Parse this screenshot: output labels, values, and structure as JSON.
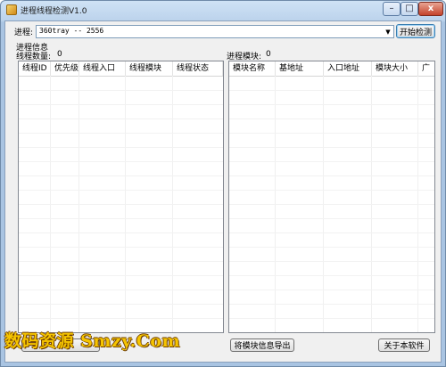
{
  "window": {
    "title": "进程线程检测V1.0",
    "controls": {
      "minimize": "–",
      "maximize": "□",
      "close": "x"
    }
  },
  "process": {
    "label": "进程:",
    "selected": "360tray -- 2556",
    "start_button": "开始检测"
  },
  "process_info": {
    "label": "进程信息"
  },
  "threads": {
    "count_label": "线程数量:",
    "count": "0",
    "columns": [
      "线程ID",
      "优先级",
      "线程入口",
      "线程模块",
      "线程状态"
    ],
    "rows": []
  },
  "modules": {
    "label": "进程模块:",
    "count": "0",
    "columns": [
      "模块名称",
      "基地址",
      "入口地址",
      "模块大小",
      "广"
    ],
    "rows": [],
    "export_button": "将模块信息导出",
    "about_button": "关于本软件"
  },
  "watermark": {
    "text": "数码资源 Smzy.Com",
    "color": "#f5c400"
  }
}
